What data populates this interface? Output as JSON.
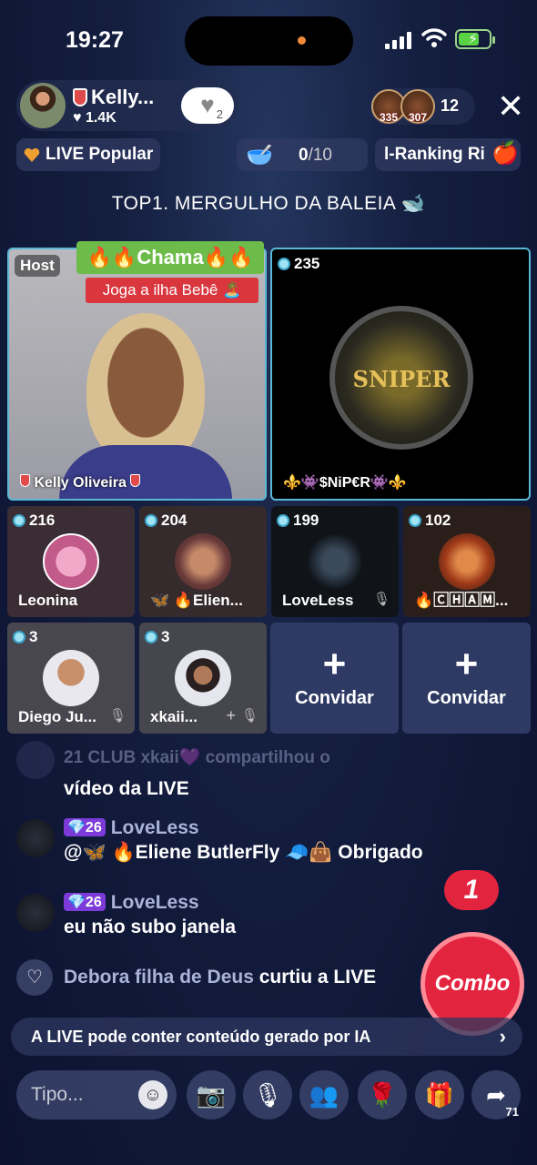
{
  "status": {
    "time": "19:27"
  },
  "host": {
    "name": "Kelly...",
    "likes": "1.4K",
    "heart_count": "2"
  },
  "viewers": {
    "badge1": "335",
    "badge2": "307",
    "count": "12"
  },
  "top_bar": {
    "popular": "LIVE Popular",
    "goal_current": "0",
    "goal_total": "/10",
    "ranking": "l-Ranking Ri"
  },
  "headline": "TOP1. MERGULHO DA BALEIA 🐋",
  "main_tiles": {
    "host_tag": "Host",
    "host_name": "Kelly Oliveira",
    "chama_banner": "🔥🔥Chama🔥🔥",
    "joga_banner": "Joga a ilha Bebê 🏝️",
    "sniper_score": "235",
    "sniper_logo": "SNIPER",
    "sniper_name": "⚜️👾$NiP€R👾⚜️"
  },
  "seats": [
    {
      "score": "216",
      "name": "Leonina",
      "muted": false
    },
    {
      "score": "204",
      "name": "🦋 🔥Elien...",
      "muted": false
    },
    {
      "score": "199",
      "name": "LoveLess",
      "muted": true
    },
    {
      "score": "102",
      "name": "🔥🄲🄷🄰🄼...",
      "muted": false
    },
    {
      "score": "3",
      "name": "Diego Ju...",
      "muted": true
    },
    {
      "score": "3",
      "name": "xkaii...",
      "muted": true
    }
  ],
  "invite": {
    "label": "Convidar"
  },
  "chat": {
    "faded_header": "21 CLUB xkaii💜 compartilhou o",
    "faded_line2": "vídeo da LIVE",
    "msg1_level": "26",
    "msg1_name": "LoveLess",
    "msg1_text": "@🦋 🔥Eliene ButlerFly 🧢👜 Obrigado",
    "msg2_level": "26",
    "msg2_name": "LoveLess",
    "msg2_text": "eu não subo janela",
    "like_user": "Debora filha de Deus",
    "like_text": "curtiu a LIVE"
  },
  "combo": {
    "label": "Combo",
    "count": "1"
  },
  "ai_banner": "A LIVE pode conter conteúdo gerado por IA",
  "bottom": {
    "input_placeholder": "Tipo...",
    "share_count": "71"
  },
  "colors": {
    "accent_tile_border": "#5ab8d6",
    "combo_red": "#e3243f",
    "chama_green": "#6dbc4a",
    "joga_red": "#d9363e"
  }
}
